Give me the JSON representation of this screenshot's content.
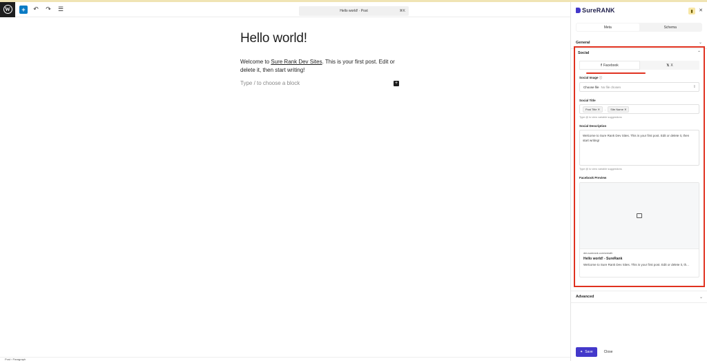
{
  "toolbar": {
    "add_icon": "plus-icon",
    "command_label": "Hello world! · Post",
    "command_shortcut": "⌘K"
  },
  "editor": {
    "title": "Hello world!",
    "body_before": "Welcome to ",
    "body_link": "Sure Rank Dev Sites",
    "body_after": ". This is your first post. Edit or delete it, then start writing!",
    "placeholder": "Type / to choose a block"
  },
  "footer": {
    "breadcrumb": "Post  ›  Paragraph"
  },
  "panel": {
    "brand": "SureRANK",
    "tabs": [
      "Meta",
      "Schema"
    ],
    "general_label": "General",
    "social_label": "Social",
    "social_tabs": [
      "Facebook",
      "X"
    ],
    "social_image_label": "Social Image",
    "choose_file": "Choose file",
    "no_file": "No file chosen",
    "social_title_label": "Social Title",
    "chips": [
      "Post Title",
      "Site Name"
    ],
    "chip_sep": "-",
    "hint": "Type @ to view variable suggestions",
    "social_desc_label": "Social Description",
    "social_desc_value": "Welcome to Sure Rank Dev Sites. This is your first post. Edit or delete it, then start writing!",
    "preview_label": "Facebook Preview",
    "preview_url": "dev.surerank.com/wreath",
    "preview_title": "Hello world! - SureRank",
    "preview_desc": "Welcome to Sure Rank Dev Sites. This is your first post. Edit or delete it, th...",
    "advanced_label": "Advanced",
    "save_label": "Save",
    "close_label": "Close"
  }
}
